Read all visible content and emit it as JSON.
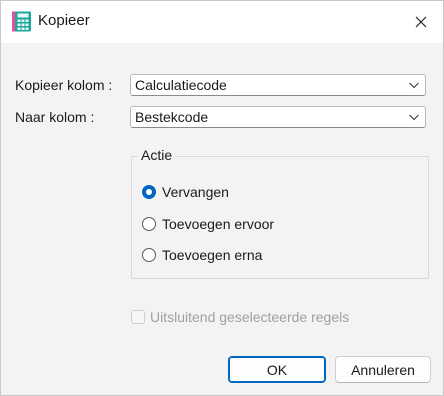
{
  "window": {
    "title": "Kopieer",
    "icon": "calculator-icon",
    "close_icon": "close-icon"
  },
  "form": {
    "from_label": "Kopieer kolom :",
    "from_value": "Calculatiecode",
    "to_label": "Naar kolom :",
    "to_value": "Bestekcode"
  },
  "action_group": {
    "title": "Actie",
    "options": [
      {
        "label": "Vervangen",
        "checked": true
      },
      {
        "label": "Toevoegen ervoor",
        "checked": false
      },
      {
        "label": "Toevoegen erna",
        "checked": false
      }
    ]
  },
  "selected_only": {
    "label": "Uitsluitend geselecteerde regels",
    "checked": false,
    "enabled": false
  },
  "buttons": {
    "ok": "OK",
    "cancel": "Annuleren"
  },
  "colors": {
    "accent": "#0067c0",
    "disabled_text": "#a0a0a0"
  }
}
